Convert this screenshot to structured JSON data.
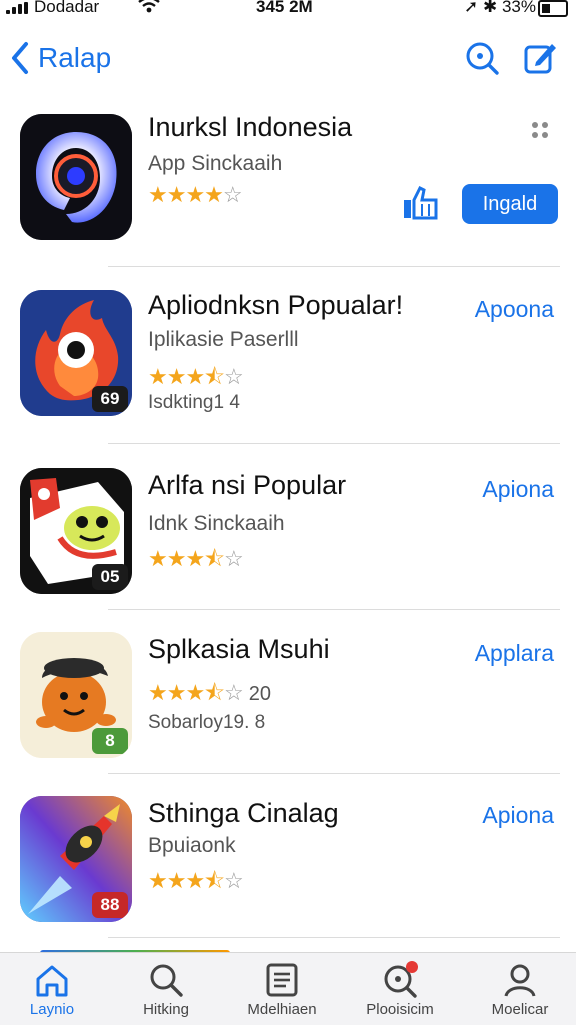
{
  "status_bar": {
    "carrier": "Dodadar",
    "time": "345 2M",
    "battery": "33%"
  },
  "nav": {
    "back_label": "Ralap"
  },
  "apps": [
    {
      "title": "Inurksl Indonesia",
      "subtitle": "App Sinckaaih",
      "rating": 3.5,
      "action": "Ingald",
      "badge": ""
    },
    {
      "title": "Apliodnksn Popualar!",
      "subtitle": "Iplikasie Paserlll",
      "rating": 3.5,
      "meta": "Isdkting1 4",
      "action": "Apoona",
      "badge": "69"
    },
    {
      "title": "Arlfa  nsi Popular",
      "subtitle": "Idnk Sinckaaih",
      "rating": 3.5,
      "action": "Apiona",
      "badge": "05"
    },
    {
      "title": "Splkasia Msuhi",
      "rating": 3.5,
      "rating_count": "20",
      "meta": "Sobarloy19. 8",
      "action": "Applara",
      "badge": "8"
    },
    {
      "title": "Sthinga Cinalag",
      "subtitle": "Bpuiaonk",
      "rating": 3.5,
      "action": "Apiona",
      "badge": "88"
    }
  ],
  "tabs": [
    {
      "label": "Laynio",
      "icon": "home-icon"
    },
    {
      "label": "Hitking",
      "icon": "search-icon"
    },
    {
      "label": "Mdelhiaen",
      "icon": "list-icon"
    },
    {
      "label": "Plooisicim",
      "icon": "updates-icon"
    },
    {
      "label": "Moelicar",
      "icon": "profile-icon"
    }
  ],
  "colors": {
    "accent": "#1a73e8",
    "star": "#f4a51c"
  }
}
